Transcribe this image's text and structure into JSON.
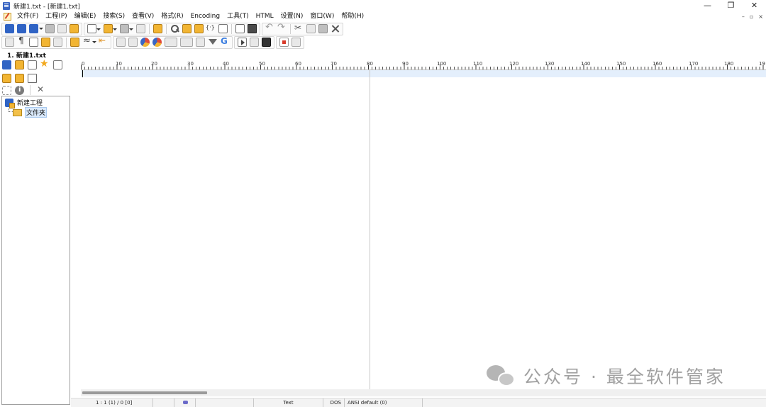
{
  "window": {
    "title": "新建1.txt - [新建1.txt]",
    "minimize": "—",
    "restore": "❐",
    "close": "✕"
  },
  "menu": {
    "items": [
      {
        "label": "文件(F)"
      },
      {
        "label": "工程(P)"
      },
      {
        "label": "编辑(E)"
      },
      {
        "label": "搜索(S)"
      },
      {
        "label": "查看(V)"
      },
      {
        "label": "格式(R)"
      },
      {
        "label": "Encoding"
      },
      {
        "label": "工具(T)"
      },
      {
        "label": "HTML"
      },
      {
        "label": "设置(N)"
      },
      {
        "label": "窗口(W)"
      },
      {
        "label": "帮助(H)"
      }
    ],
    "mdi": {
      "minimize": "–",
      "restore": "▫",
      "close": "×"
    }
  },
  "sidebar": {
    "file_tab": "1. 新建1.txt",
    "tree": {
      "project": "新建工程",
      "folder": "文件夹"
    }
  },
  "ruler": {
    "labels": [
      "0",
      "10",
      "20",
      "30",
      "40",
      "50",
      "60",
      "70",
      "80",
      "90",
      "100",
      "110",
      "120",
      "130",
      "140",
      "150",
      "160",
      "170",
      "180",
      "19"
    ]
  },
  "statusbar": {
    "position": "1 : 1 (1) / 0  [0]",
    "filetype": "Text",
    "line_ending": "DOS",
    "encoding": "ANSI default (0)"
  },
  "watermark": {
    "text": "公众号 · 最全软件管家"
  },
  "colors": {
    "current_line": "#e4effc",
    "accent_blue": "#2f63c4",
    "folder_gold": "#f2c04a"
  }
}
